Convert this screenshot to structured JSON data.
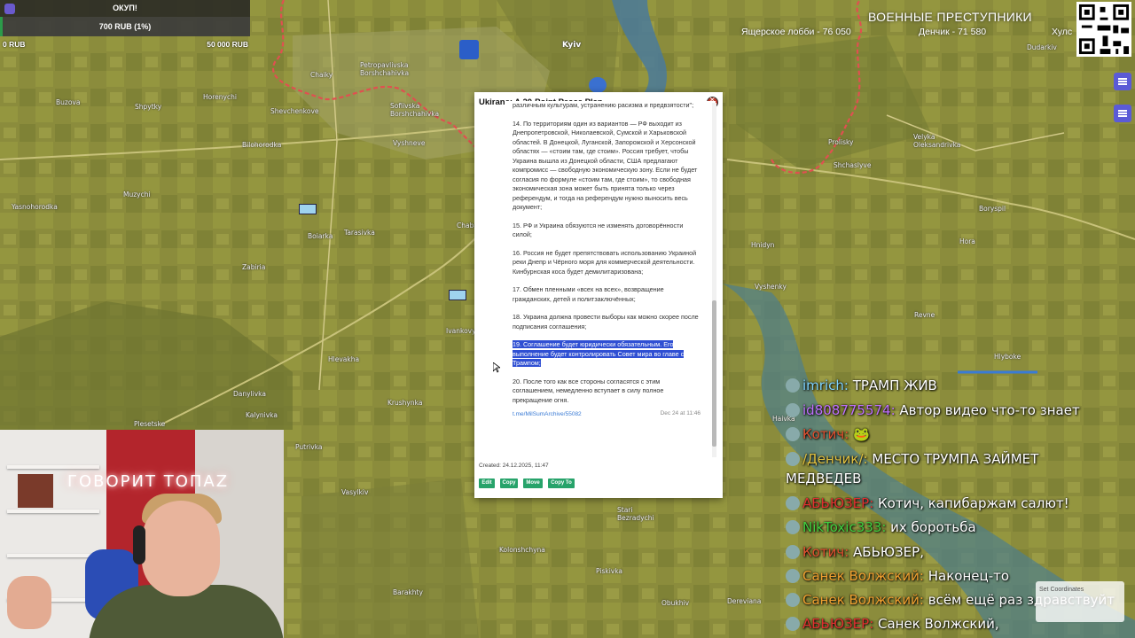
{
  "goal": {
    "title": "ОКУП!",
    "amount": "700 RUB (1%)",
    "progress_percent": 1,
    "min": "0 RUB",
    "max": "50 000 RUB"
  },
  "ranking": {
    "title": "ВОЕННЫЕ ПРЕСТУПНИКИ",
    "items": [
      "Ящерское лобби - 76 050",
      "Денчик - 71 580",
      "Хулс"
    ]
  },
  "map_labels": {
    "kyiv": "Kyiv",
    "buzova": "Buzova",
    "shpytky": "Shpytky",
    "horenychi": "Horenychi",
    "shevchenkove": "Shevchenkove",
    "bilohorodka": "Bilohorodka",
    "muzychi": "Muzychi",
    "yasnohorodka": "Yasnohorodka",
    "boiarka": "Boiarka",
    "tarasivka": "Tarasivka",
    "zabiria": "Zabiria",
    "hlevakha": "Hlevakha",
    "danylivka": "Danylivka",
    "kalynivka": "Kalynivka",
    "plesetske": "Plesetske",
    "putrivka": "Putrivka",
    "krushynka": "Krushynka",
    "vasylkiv": "Vasylkiv",
    "ivankovychi": "Ivankovychi",
    "chaba": "Chaba",
    "vyshneve": "Vyshneve",
    "petropavlivska": "Petropavlivska Borshchahivka",
    "sofiivska": "Sofiivska Borshchahivka",
    "chaiky": "Chaiky",
    "velyka": "Velyka Oleksandrivka",
    "prolisky": "Prolisky",
    "shchaslyve": "Shchaslyve",
    "borysil": "Boryspil",
    "vyshenky": "Vyshenky",
    "hnidyn": "Hnidyn",
    "revne": "Revne",
    "hlyboke": "Hlyboke",
    "dudarkiv": "Dudarkiv",
    "barakhty": "Barakhty",
    "derevianа": "Dereviana",
    "obukhiv": "Obukhiv",
    "stari": "Stari Bezradychi",
    "kolonshchyna": "Kolonshchyna",
    "piskivka": "Piskivka",
    "hora": "Hora",
    "halyi": "Haivka"
  },
  "popup": {
    "title": "Ukirane: A 20-Point Peace Plan",
    "paragraphs": [
      "различным культурам, устранению расизма и предвзятости\";",
      "14. По территориям один из вариантов — РФ выходит из Днепропетровской, Николаевской, Сумской и Харьковской областей. В Донецкой, Луганской, Запорожской и Херсонской областях — «стоим там, где стоим». Россия требует, чтобы Украина вышла из Донецкой области, США предлагают компромисс — свободную экономическую зону. Если не будет согласия по формуле «стоим там, где стоим», то свободная экономическая зона может быть принята только через референдум, и тогда на референдум нужно выносить весь документ;",
      "15. РФ и Украина обязуются не изменять договорённости силой;",
      "16. Россия не будет препятствовать использованию Украиной реки Днепр и Чёрного моря для коммерческой деятельности. Кинбурнская коса будет демилитаризована;",
      "17. Обмен пленными «всех на всех», возвращение гражданских, детей и политзаключённых;",
      "18. Украина должна провести выборы как можно скорее после подписания соглашения;"
    ],
    "highlighted": "19. Соглашение будет юридически обязательным. Его выполнение будет контролировать Совет мира во главе с Трампом;",
    "last_paragraph": "20. После того как все стороны согласятся с этим соглашением, немедленно вступает в силу полное прекращение огня.",
    "link": "t.me/MilSumArchive/55082",
    "date": "Dec 24 at 11:46",
    "created": "Created: 24.12.2025, 11:47",
    "buttons": [
      "Edit",
      "Copy",
      "Move",
      "Copy To"
    ]
  },
  "webcam": {
    "neon_sign": "ГОВОРИТ ТОПАZ"
  },
  "chat": [
    {
      "user": "imrich",
      "text": "ТРАМП ЖИВ",
      "color": "#7fd3ff"
    },
    {
      "user": "id808775574",
      "text": "Автор видео что-то знает",
      "color": "#c070ff"
    },
    {
      "user": "Котич",
      "text": "🐸",
      "color": "#e05030"
    },
    {
      "user": "/Денчик/",
      "text": "МЕСТО ТРУМПА ЗАЙМЕТ",
      "color": "#e0c040"
    },
    {
      "user": "",
      "text": "МЕДВЕДЕВ",
      "color": "#ffffff"
    },
    {
      "user": "АБЬЮЗЕР",
      "text": "Котич, капибаржам салют!",
      "color": "#e03030"
    },
    {
      "user": "NikToxic333",
      "text": "их боротьба",
      "color": "#40d040"
    },
    {
      "user": "Котич",
      "text": "АБЬЮЗЕР,",
      "color": "#e05030"
    },
    {
      "user": "Санек Волжский",
      "text": "Наконец-то",
      "color": "#f0a030"
    },
    {
      "user": "Санек Волжский",
      "text": "всём ещё раз здравствуйт",
      "color": "#f0a030"
    },
    {
      "user": "АБЬЮЗЕР",
      "text": "Санек Волжский,",
      "color": "#e03030"
    }
  ],
  "coordinates": {
    "label": "Set Coordinates"
  },
  "colors": {
    "map_olive": "#8a8a3a",
    "frontline": "#e05050",
    "river": "#4a7a9a",
    "button_green": "#27a36a",
    "highlight": "#2f4fd3"
  }
}
